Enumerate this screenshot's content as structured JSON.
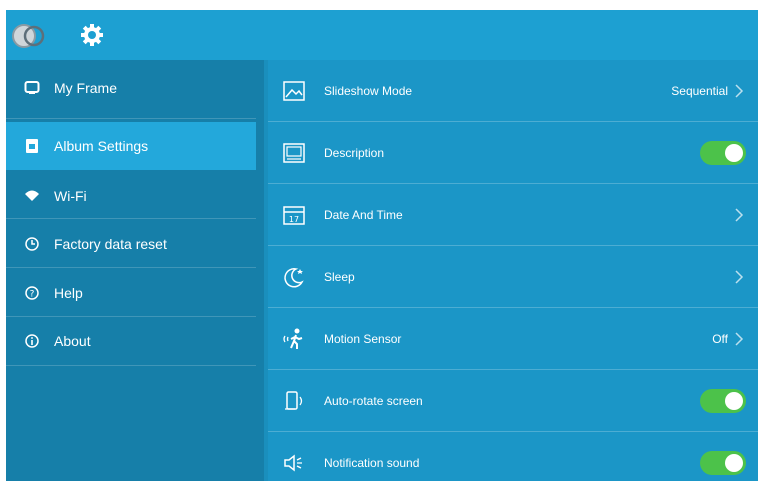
{
  "topbar": {
    "back_icon": "toggle-off-icon",
    "settings_icon": "gear-icon"
  },
  "sidebar": {
    "items": [
      {
        "label": "My Frame",
        "icon": "frame-icon",
        "active": false
      },
      {
        "label": "Album Settings",
        "icon": "album-icon",
        "active": true
      },
      {
        "label": "Wi-Fi",
        "icon": "wifi-icon",
        "active": false
      },
      {
        "label": "Factory data reset",
        "icon": "reset-icon",
        "active": false
      },
      {
        "label": "Help",
        "icon": "help-icon",
        "active": false
      },
      {
        "label": "About",
        "icon": "info-icon",
        "active": false
      }
    ]
  },
  "settings": {
    "rows": [
      {
        "label": "Slideshow Mode",
        "icon": "slideshow-icon",
        "value": "Sequential",
        "control": "chevron"
      },
      {
        "label": "Description",
        "icon": "description-icon",
        "control": "toggle",
        "on": true
      },
      {
        "label": "Date And Time",
        "icon": "calendar-icon",
        "control": "chevron"
      },
      {
        "label": "Sleep",
        "icon": "moon-icon",
        "control": "chevron"
      },
      {
        "label": "Motion Sensor",
        "icon": "motion-icon",
        "value": "Off",
        "control": "chevron"
      },
      {
        "label": "Auto-rotate screen",
        "icon": "rotate-icon",
        "control": "toggle",
        "on": true
      },
      {
        "label": "Notification sound",
        "icon": "speaker-icon",
        "control": "toggle",
        "on": true
      }
    ]
  },
  "colors": {
    "topbar": "#1da0d2",
    "sidebar": "#167fa9",
    "sidebar_active": "#23a8db",
    "main": "#1b96c7",
    "toggle_on": "#4cc24a"
  }
}
